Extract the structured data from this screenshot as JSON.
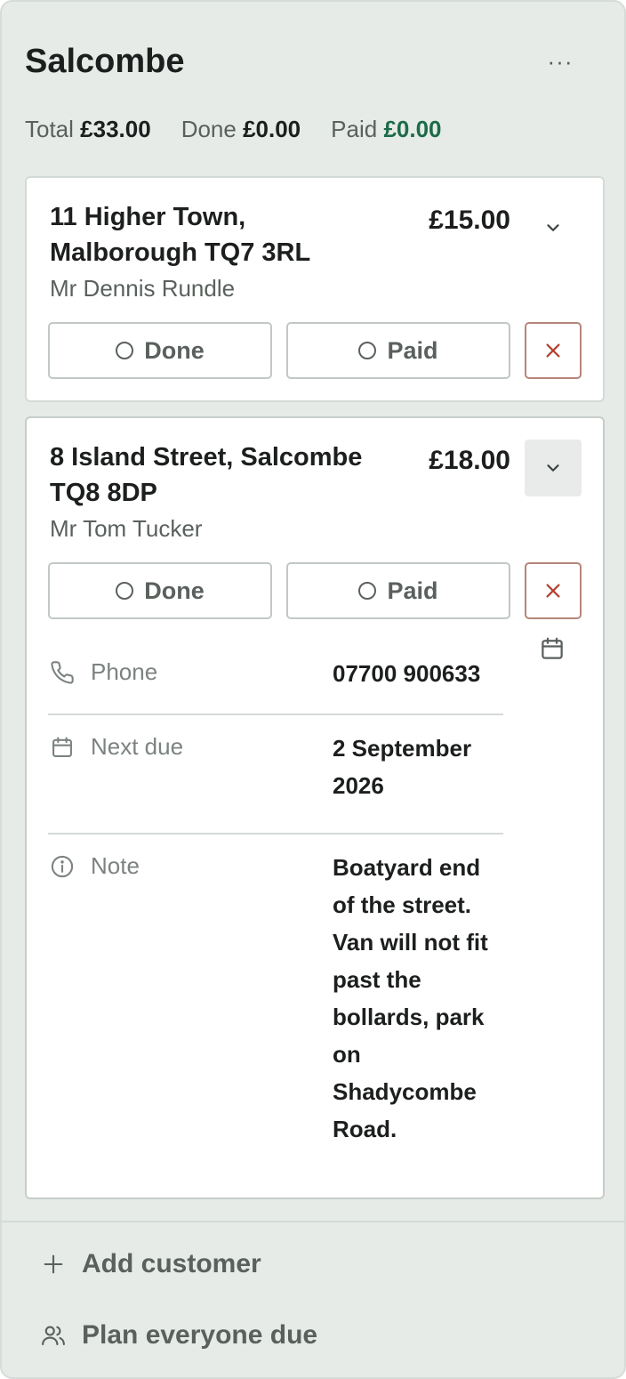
{
  "round": {
    "title": "Salcombe",
    "more_label": "···",
    "totals": [
      {
        "label": "Total",
        "value": "£33.00"
      },
      {
        "label": "Done",
        "value": "£0.00"
      },
      {
        "label": "Paid",
        "value": "£0.00"
      }
    ]
  },
  "customers": [
    {
      "address": "11 Higher Town, Malborough TQ7 3RL",
      "name": "Mr Dennis Rundle",
      "price": "£15.00",
      "done_label": "Done",
      "paid_label": "Paid",
      "expanded": false
    },
    {
      "address": "8 Island Street, Salcombe TQ8 8DP",
      "name": "Mr Tom Tucker",
      "price": "£18.00",
      "done_label": "Done",
      "paid_label": "Paid",
      "expanded": true,
      "details": {
        "phone_label": "Phone",
        "phone": "07700 900633",
        "next_due_label": "Next due",
        "next_due": "2 September 2026",
        "note_label": "Note",
        "note": "Boatyard end of the street. Van will not fit past the bollards, park on Shadycombe Road."
      }
    }
  ],
  "footer": {
    "add_customer": "Add customer",
    "plan_everyone": "Plan everyone due"
  },
  "colors": {
    "accent_paid": "#1e6b49",
    "delete": "#b5412f",
    "panel_bg": "#e6ebe8"
  },
  "icons": {
    "more": "more-icon",
    "expand": "chevron-down-icon",
    "delete": "close-icon",
    "phone": "phone-icon",
    "calendar": "calendar-icon",
    "note": "info-icon",
    "add": "plus-icon",
    "plan": "users-icon"
  }
}
